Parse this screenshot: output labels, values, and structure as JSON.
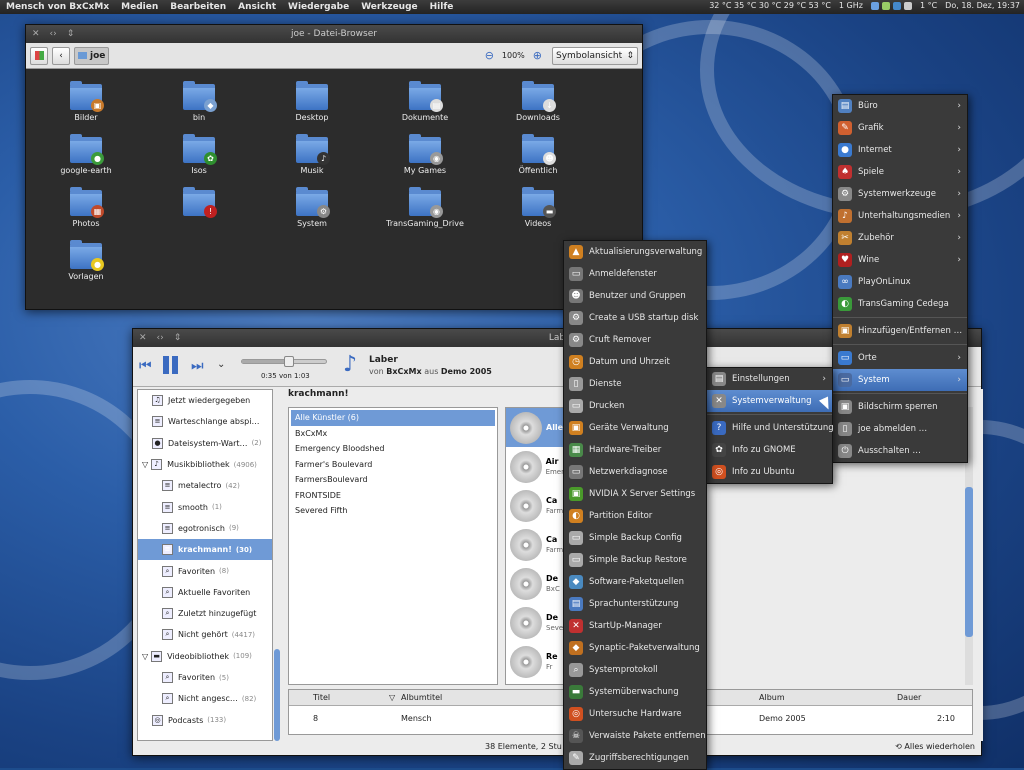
{
  "panel": {
    "menus": [
      "Mensch von BxCxMx",
      "Medien",
      "Bearbeiten",
      "Ansicht",
      "Wiedergabe",
      "Werkzeuge",
      "Hilfe"
    ],
    "temps": "32 °C 35 °C 30 °C 29 °C 53 °C",
    "cpu": "1 GHz",
    "weather": "1 °C",
    "clock": "Do, 18. Dez, 19:37"
  },
  "filebrowser": {
    "title": "joe - Datei-Browser",
    "location": "joe",
    "zoom": "100%",
    "view_mode": "Symbolansicht",
    "items": [
      {
        "label": "Bilder",
        "badge": "▣",
        "color": "#c8792a"
      },
      {
        "label": "bin",
        "badge": "◆",
        "color": "#7aa0d0"
      },
      {
        "label": "Desktop",
        "badge": "",
        "color": ""
      },
      {
        "label": "Dokumente",
        "badge": "▤",
        "color": "#dddddd"
      },
      {
        "label": "Downloads",
        "badge": "↓",
        "color": "#dddddd"
      },
      {
        "label": "google-earth",
        "badge": "●",
        "color": "#3b9b3b"
      },
      {
        "label": "Isos",
        "badge": "✿",
        "color": "#2f8f2f"
      },
      {
        "label": "Musik",
        "badge": "♪",
        "color": "#333333"
      },
      {
        "label": "My Games",
        "badge": "◉",
        "color": "#999999"
      },
      {
        "label": "Öffentlich",
        "badge": "☻",
        "color": "#dddddd"
      },
      {
        "label": "Photos",
        "badge": "▦",
        "color": "#c04a2a"
      },
      {
        "label": "",
        "badge": "!",
        "color": "#c02020"
      },
      {
        "label": "System",
        "badge": "⚙",
        "color": "#888888"
      },
      {
        "label": "TransGaming_Drive",
        "badge": "◉",
        "color": "#999999"
      },
      {
        "label": "Videos",
        "badge": "▬",
        "color": "#555555"
      },
      {
        "label": "Vorlagen",
        "badge": "●",
        "color": "#e8c820"
      }
    ]
  },
  "player": {
    "title": "Lab",
    "track": "Laber",
    "by_label": "von",
    "artist": "BxCxMx",
    "from_label": "aus",
    "album": "Demo 2005",
    "time": "0:35 von 1:03",
    "section": "krachmann!",
    "sidebar": [
      {
        "label": "Jetzt wiedergegeben",
        "count": "",
        "indent": 1,
        "icon": "♫"
      },
      {
        "label": "Warteschlange abspi…",
        "count": "",
        "indent": 1,
        "icon": "≡"
      },
      {
        "label": "Dateisystem-Wart…",
        "count": "(2)",
        "indent": 1,
        "icon": "●"
      },
      {
        "label": "Musikbibliothek",
        "count": "(4906)",
        "indent": 0,
        "icon": "♪"
      },
      {
        "label": "metalectro",
        "count": "(42)",
        "indent": 2,
        "icon": "≡"
      },
      {
        "label": "smooth",
        "count": "(1)",
        "indent": 2,
        "icon": "≡"
      },
      {
        "label": "egotronisch",
        "count": "(9)",
        "indent": 2,
        "icon": "≡"
      },
      {
        "label": "krachmann!",
        "count": "(30)",
        "indent": 2,
        "icon": "≡",
        "sel": true
      },
      {
        "label": "Favoriten",
        "count": "(8)",
        "indent": 2,
        "icon": "⌕"
      },
      {
        "label": "Aktuelle Favoriten",
        "count": "",
        "indent": 2,
        "icon": "⌕"
      },
      {
        "label": "Zuletzt hinzugefügt",
        "count": "",
        "indent": 2,
        "icon": "⌕"
      },
      {
        "label": "Nicht gehört",
        "count": "(4417)",
        "indent": 2,
        "icon": "⌕"
      },
      {
        "label": "Videobibliothek",
        "count": "(109)",
        "indent": 0,
        "icon": "▬"
      },
      {
        "label": "Favoriten",
        "count": "(5)",
        "indent": 2,
        "icon": "⌕"
      },
      {
        "label": "Nicht angesc…",
        "count": "(82)",
        "indent": 2,
        "icon": "⌕"
      },
      {
        "label": "Podcasts",
        "count": "(133)",
        "indent": 1,
        "icon": "◎"
      }
    ],
    "artists": [
      "Alle Künstler (6)",
      "BxCxMx",
      "Emergency Bloodshed",
      "Farmer's Boulevard",
      "FarmersBoulevard",
      "FRONTSIDE",
      "Severed Fifth"
    ],
    "albums": [
      {
        "title": "Alle",
        "sub": ""
      },
      {
        "title": "Air",
        "sub": "Emer"
      },
      {
        "title": "Ca",
        "sub": "Farm"
      },
      {
        "title": "Ca",
        "sub": "Farm"
      },
      {
        "title": "De",
        "sub": "BxC"
      },
      {
        "title": "De",
        "sub": "Seve"
      },
      {
        "title": "Re",
        "sub": "Fr"
      }
    ],
    "columns": {
      "title": "Titel",
      "album": "Albumtitel",
      "album2": "Album",
      "duration": "Dauer"
    },
    "row": {
      "num": "8",
      "title": "Mensch",
      "album": "Demo 2005",
      "duration": "2:10"
    },
    "status": "38 Elemente, 2 Stu",
    "repeat": "Alles wiederholen"
  },
  "main_menu": [
    {
      "label": "Büro",
      "arrow": true,
      "color": "#5080c0",
      "icon": "▤"
    },
    {
      "label": "Grafik",
      "arrow": true,
      "color": "#d06030",
      "icon": "✎"
    },
    {
      "label": "Internet",
      "arrow": true,
      "color": "#3a7ad0",
      "icon": "●"
    },
    {
      "label": "Spiele",
      "arrow": true,
      "color": "#c03030",
      "icon": "♠"
    },
    {
      "label": "Systemwerkzeuge",
      "arrow": true,
      "color": "#888888",
      "icon": "⚙"
    },
    {
      "label": "Unterhaltungsmedien",
      "arrow": true,
      "color": "#c07030",
      "icon": "♪"
    },
    {
      "label": "Zubehör",
      "arrow": true,
      "color": "#c08030",
      "icon": "✂"
    },
    {
      "label": "Wine",
      "arrow": true,
      "color": "#b02020",
      "icon": "♥"
    },
    {
      "label": "PlayOnLinux",
      "arrow": false,
      "color": "#4a7ac0",
      "icon": "∞"
    },
    {
      "label": "TransGaming Cedega",
      "arrow": false,
      "color": "#3a9a3a",
      "icon": "◐"
    },
    {
      "sep": true
    },
    {
      "label": "Hinzufügen/Entfernen …",
      "arrow": false,
      "color": "#c08030",
      "icon": "▣"
    },
    {
      "sep": true
    },
    {
      "label": "Orte",
      "arrow": true,
      "color": "#3a7ad0",
      "icon": "▭"
    },
    {
      "label": "System",
      "arrow": true,
      "color": "#4a6aa0",
      "icon": "▭",
      "hl": true
    },
    {
      "sep": true
    },
    {
      "label": "Bildschirm sperren",
      "arrow": false,
      "color": "#888888",
      "icon": "▣"
    },
    {
      "label": "joe abmelden …",
      "arrow": false,
      "color": "#888888",
      "icon": "▯"
    },
    {
      "label": "Ausschalten …",
      "arrow": false,
      "color": "#888888",
      "icon": "⏻"
    }
  ],
  "system_menu": [
    {
      "label": "Einstellungen",
      "arrow": true,
      "color": "#888888",
      "icon": "▤"
    },
    {
      "label": "Systemverwaltung",
      "arrow": true,
      "color": "#888888",
      "icon": "✕",
      "hl": true
    },
    {
      "sep": true
    },
    {
      "label": "Hilfe und Unterstützung",
      "arrow": false,
      "color": "#3a6ac0",
      "icon": "?"
    },
    {
      "label": "Info zu GNOME",
      "arrow": false,
      "color": "#444444",
      "icon": "✿"
    },
    {
      "label": "Info zu Ubuntu",
      "arrow": false,
      "color": "#d05020",
      "icon": "◎"
    }
  ],
  "admin_menu": [
    {
      "label": "Aktualisierungsverwaltung",
      "color": "#d08020",
      "icon": "▲"
    },
    {
      "label": "Anmeldefenster",
      "color": "#777777",
      "icon": "▭"
    },
    {
      "label": "Benutzer und Gruppen",
      "color": "#777777",
      "icon": "☻"
    },
    {
      "label": "Create a USB startup disk",
      "color": "#888888",
      "icon": "⚙"
    },
    {
      "label": "Cruft Remover",
      "color": "#888888",
      "icon": "⚙"
    },
    {
      "label": "Datum und Uhrzeit",
      "color": "#d08020",
      "icon": "◷"
    },
    {
      "label": "Dienste",
      "color": "#999999",
      "icon": "▯"
    },
    {
      "label": "Drucken",
      "color": "#aaaaaa",
      "icon": "▭"
    },
    {
      "label": "Geräte Verwaltung",
      "color": "#d08020",
      "icon": "▣"
    },
    {
      "label": "Hardware-Treiber",
      "color": "#4a8a4a",
      "icon": "▦"
    },
    {
      "label": "Netzwerkdiagnose",
      "color": "#777777",
      "icon": "▭"
    },
    {
      "label": "NVIDIA X Server Settings",
      "color": "#4a9a2a",
      "icon": "▣"
    },
    {
      "label": "Partition Editor",
      "color": "#d08020",
      "icon": "◐"
    },
    {
      "label": "Simple Backup Config",
      "color": "#aaaaaa",
      "icon": "▭"
    },
    {
      "label": "Simple Backup Restore",
      "color": "#aaaaaa",
      "icon": "▭"
    },
    {
      "label": "Software-Paketquellen",
      "color": "#4a8ac0",
      "icon": "◆"
    },
    {
      "label": "Sprachunterstützung",
      "color": "#4a7ac0",
      "icon": "▤"
    },
    {
      "label": "StartUp-Manager",
      "color": "#c03030",
      "icon": "✕"
    },
    {
      "label": "Synaptic-Paketverwaltung",
      "color": "#c07020",
      "icon": "◆"
    },
    {
      "label": "Systemprotokoll",
      "color": "#999999",
      "icon": "⌕"
    },
    {
      "label": "Systemüberwachung",
      "color": "#3a7a3a",
      "icon": "▬"
    },
    {
      "label": "Untersuche Hardware",
      "color": "#d05020",
      "icon": "◎"
    },
    {
      "label": "Verwaiste Pakete entfernen",
      "color": "#555555",
      "icon": "☠"
    },
    {
      "label": "Zugriffsberechtigungen",
      "color": "#aaaaaa",
      "icon": "✎"
    }
  ]
}
